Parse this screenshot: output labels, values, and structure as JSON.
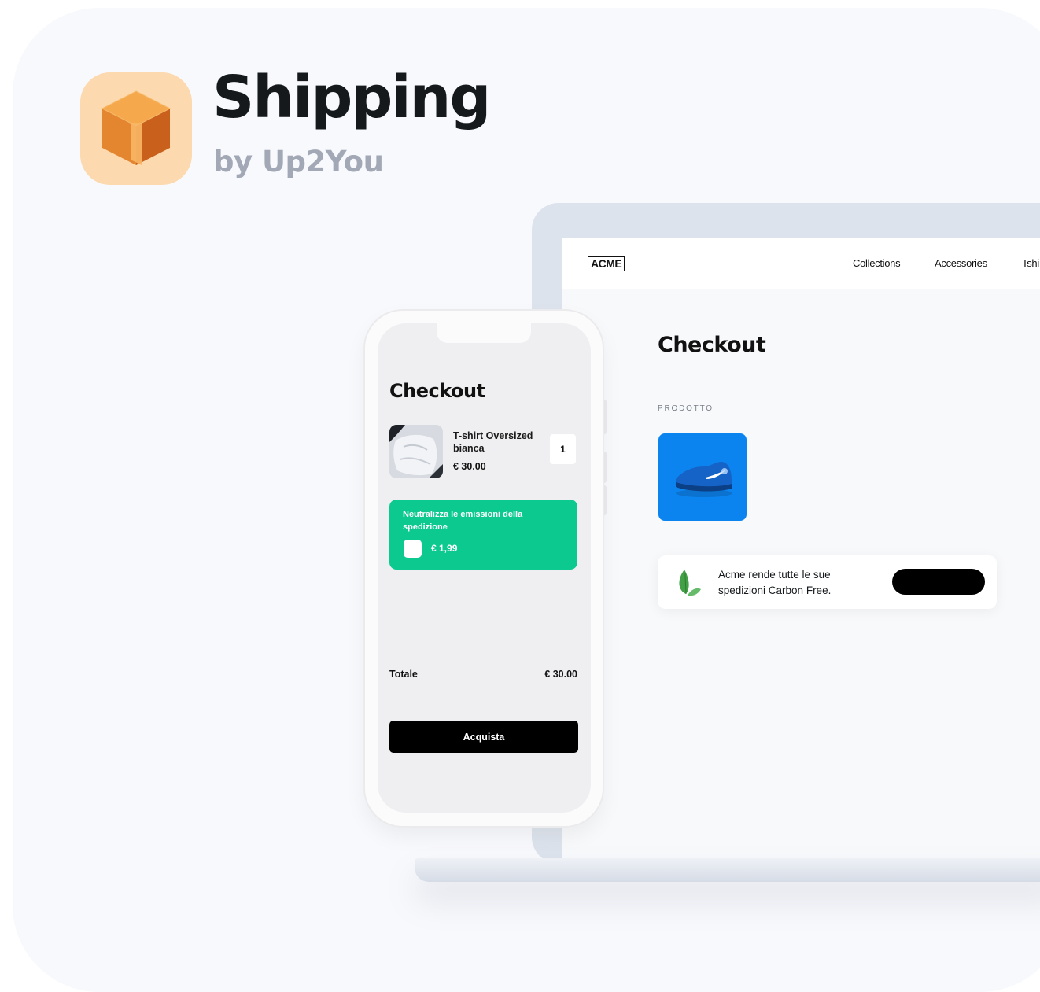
{
  "header": {
    "title": "Shipping",
    "subtitle": "by Up2You",
    "icon": "package-box-icon",
    "icon_bg_color": "#fcd9ae"
  },
  "desktop": {
    "logo": "ACME",
    "nav": [
      "Collections",
      "Accessories",
      "Tshi"
    ],
    "heading": "Checkout",
    "column_header": "PRODOTTO",
    "product_image": "blue-sneaker-image",
    "carbon_text": "Acme rende tutte le sue spedizioni Carbon Free.",
    "carbon_icon": "leaf-icon",
    "toggle_color": "#000000"
  },
  "mobile": {
    "heading": "Checkout",
    "item": {
      "name": "T-shirt Oversized bianca",
      "price": "€ 30.00",
      "quantity": "1",
      "image": "white-tshirt-image"
    },
    "offset": {
      "text": "Neutralizza le emissioni della spedizione",
      "price": "€ 1,99",
      "checked": false,
      "color": "#0bc98f"
    },
    "total_label": "Totale",
    "total_value": "€ 30.00",
    "buy_label": "Acquista"
  }
}
